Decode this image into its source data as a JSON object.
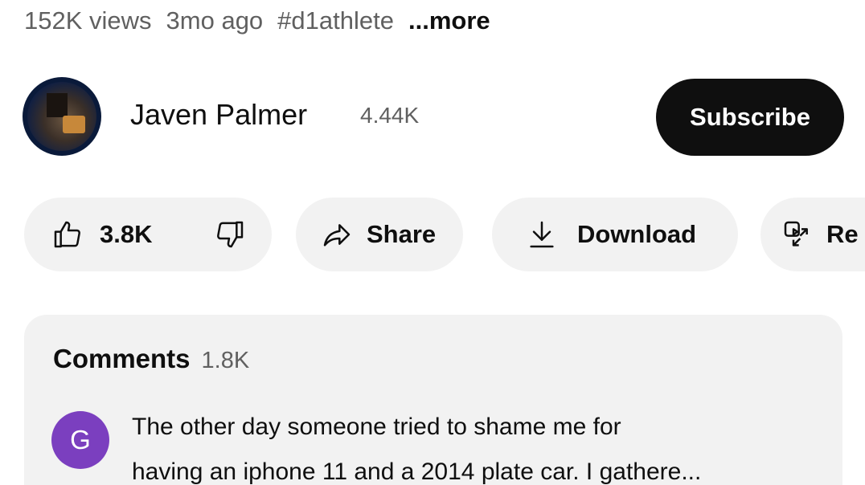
{
  "meta": {
    "views": "152K views",
    "age": "3mo ago",
    "hashtag": "#d1athlete",
    "more": "...more"
  },
  "channel": {
    "name": "Javen Palmer",
    "subscribers": "4.44K",
    "subscribe_label": "Subscribe"
  },
  "actions": {
    "like_count": "3.8K",
    "share_label": "Share",
    "download_label": "Download",
    "remix_label": "Re"
  },
  "comments": {
    "title": "Comments",
    "count": "1.8K",
    "top_comment": {
      "avatar_letter": "G",
      "avatar_color": "#7b3fbf",
      "line1": "The other day someone tried to shame me for",
      "line2": "having an iphone 11 and a 2014 plate car. I gathere..."
    }
  },
  "icons": [
    "like-icon",
    "dislike-icon",
    "share-icon",
    "download-icon",
    "remix-icon"
  ]
}
